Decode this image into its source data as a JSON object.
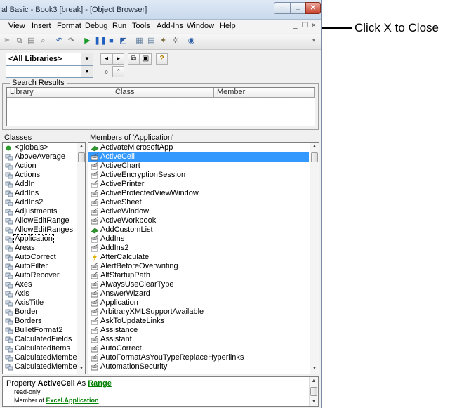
{
  "window": {
    "title": "al Basic - Book3 [break] - [Object Browser]",
    "controls": {
      "minimize": "–",
      "maximize": "□",
      "close": "✕"
    }
  },
  "menu": {
    "items": [
      "View",
      "Insert",
      "Format",
      "Debug",
      "Run",
      "Tools",
      "Add-Ins",
      "Window",
      "Help"
    ],
    "mdi_controls": [
      "_",
      "❐",
      "×"
    ]
  },
  "library_combo": {
    "value": "<All Libraries>"
  },
  "search_combo": {
    "value": ""
  },
  "search_results": {
    "title": "Search Results",
    "columns": [
      "Library",
      "Class",
      "Member"
    ]
  },
  "classes": {
    "header": "Classes",
    "items": [
      "<globals>",
      "AboveAverage",
      "Action",
      "Actions",
      "AddIn",
      "AddIns",
      "AddIns2",
      "Adjustments",
      "AllowEditRange",
      "AllowEditRanges",
      "Application",
      "Areas",
      "AutoCorrect",
      "AutoFilter",
      "AutoRecover",
      "Axes",
      "Axis",
      "AxisTitle",
      "Border",
      "Borders",
      "BulletFormat2",
      "CalculatedFields",
      "CalculatedItems",
      "CalculatedMember",
      "CalculatedMembers"
    ],
    "icons": [
      "globals",
      "class",
      "class",
      "class",
      "class",
      "class",
      "class",
      "class",
      "class",
      "class",
      "class",
      "class",
      "class",
      "class",
      "class",
      "class",
      "class",
      "class",
      "class",
      "class",
      "class",
      "class",
      "class",
      "class",
      "class"
    ],
    "focused_index": 10
  },
  "members": {
    "header": "Members of 'Application'",
    "items": [
      "ActivateMicrosoftApp",
      "ActiveCell",
      "ActiveChart",
      "ActiveEncryptionSession",
      "ActivePrinter",
      "ActiveProtectedViewWindow",
      "ActiveSheet",
      "ActiveWindow",
      "ActiveWorkbook",
      "AddCustomList",
      "AddIns",
      "AddIns2",
      "AfterCalculate",
      "AlertBeforeOverwriting",
      "AltStartupPath",
      "AlwaysUseClearType",
      "AnswerWizard",
      "Application",
      "ArbitraryXMLSupportAvailable",
      "AskToUpdateLinks",
      "Assistance",
      "Assistant",
      "AutoCorrect",
      "AutoFormatAsYouTypeReplaceHyperlinks",
      "AutomationSecurity"
    ],
    "icons": [
      "method",
      "property",
      "property",
      "property",
      "property",
      "property",
      "property",
      "property",
      "property",
      "method",
      "property",
      "property",
      "event",
      "property",
      "property",
      "property",
      "property",
      "property",
      "property",
      "property",
      "property",
      "property",
      "property",
      "property",
      "property"
    ],
    "selected_index": 1
  },
  "detail": {
    "prefix": "Property",
    "member": "ActiveCell",
    "as_word": "As",
    "type_link": "Range",
    "line2": "read-only",
    "member_of": "Member of",
    "member_of_link": "Excel.Application"
  },
  "callout": {
    "text": "Click X to Close"
  },
  "colors": {
    "selection": "#3399ff",
    "link": "#008000",
    "close_button": "#c8412c",
    "method_icon": "#2e9a2e",
    "event_icon": "#e0b000",
    "class_icon": "#5b6f86"
  }
}
